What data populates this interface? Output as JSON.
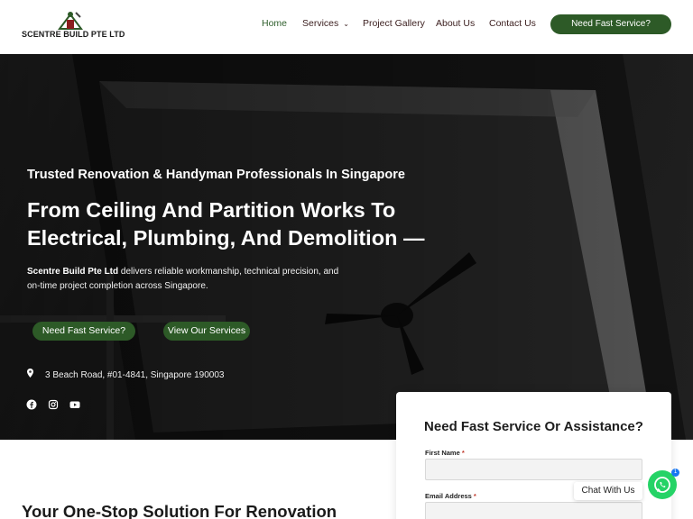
{
  "header": {
    "logo_text": "SCENTRE BUILD PTE LTD",
    "nav": [
      {
        "label": "Home",
        "active": true
      },
      {
        "label": "Services",
        "has_dropdown": true
      },
      {
        "label": "Project Gallery"
      },
      {
        "label": "About Us"
      },
      {
        "label": "Contact Us"
      }
    ],
    "cta_label": "Need Fast Service?"
  },
  "hero": {
    "eyebrow": "Trusted Renovation & Handyman Professionals In Singapore",
    "headline": "From Ceiling And Partition Works To Electrical, Plumbing, And Demolition —",
    "desc_company": "Scentre Build Pte Ltd",
    "desc_rest": " delivers reliable workmanship, technical precision, and on-time project completion across Singapore.",
    "primary_button": "Need Fast Service?",
    "secondary_button": "View Our Services",
    "address": "3 Beach Road, #01-4841, Singapore 190003",
    "social_icons": [
      "facebook-icon",
      "instagram-icon",
      "youtube-icon"
    ]
  },
  "form": {
    "title": "Need Fast Service Or Assistance?",
    "fields": [
      {
        "label": "First Name",
        "required": "*"
      },
      {
        "label": "Email Address",
        "required": "*"
      }
    ]
  },
  "section": {
    "title": "Your One-Stop Solution For Renovation"
  },
  "chat": {
    "label": "Chat With Us",
    "badge": "1"
  },
  "colors": {
    "brand_green": "#2d5a27",
    "nav_text": "#3a1d1d",
    "whatsapp": "#25d366"
  }
}
